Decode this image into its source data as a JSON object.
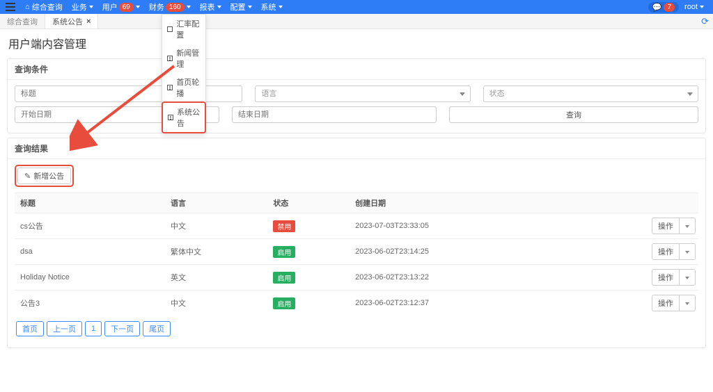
{
  "nav": {
    "home": "综合查询",
    "items": [
      "业务",
      "用户",
      "财务",
      "报表",
      "配置",
      "系统"
    ],
    "badges": {
      "user": "69",
      "finance": "160",
      "msg": "7"
    },
    "user_name": "root"
  },
  "tabs": [
    {
      "label": "综合查询",
      "closable": false
    },
    {
      "label": "系统公告",
      "closable": true
    }
  ],
  "dropdown": [
    {
      "label": "汇率配置",
      "hl": false
    },
    {
      "label": "新闻管理",
      "hl": false
    },
    {
      "label": "首页轮播",
      "hl": false
    },
    {
      "label": "系统公告",
      "hl": true
    }
  ],
  "page_title": "用户端内容管理",
  "filter": {
    "header": "查询条件",
    "title_ph": "标题",
    "lang_ph": "语言",
    "status_ph": "状态",
    "start_ph": "开始日期",
    "end_ph": "结束日期",
    "query_btn": "查询"
  },
  "results": {
    "header": "查询结果",
    "add_btn": "新增公告",
    "columns": [
      "标题",
      "语言",
      "状态",
      "创建日期",
      ""
    ],
    "rows": [
      {
        "title": "cs公告",
        "lang": "中文",
        "status": "禁用",
        "status_cls": "status-red",
        "date": "2023-07-03T23:33:05"
      },
      {
        "title": "dsa",
        "lang": "繁体中文",
        "status": "启用",
        "status_cls": "status-green",
        "date": "2023-06-02T23:14:25"
      },
      {
        "title": "Holiday Notice",
        "lang": "英文",
        "status": "启用",
        "status_cls": "status-green",
        "date": "2023-06-02T23:13:22"
      },
      {
        "title": "公告3",
        "lang": "中文",
        "status": "启用",
        "status_cls": "status-green",
        "date": "2023-06-02T23:12:37"
      }
    ],
    "action_label": "操作"
  },
  "pagination": [
    "首页",
    "上一页",
    "1",
    "下一页",
    "尾页"
  ]
}
